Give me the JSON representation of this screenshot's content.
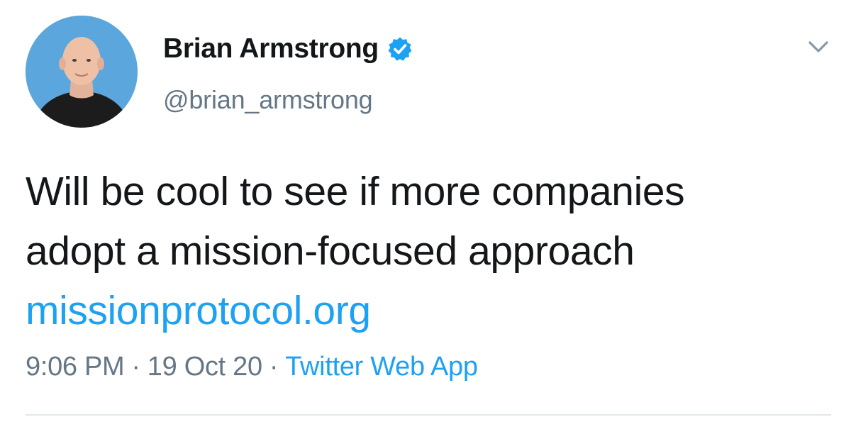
{
  "author": {
    "display_name": "Brian Armstrong",
    "handle": "@brian_armstrong",
    "verified": true
  },
  "tweet": {
    "text_line1": "Will be cool to see if more companies",
    "text_line2": "adopt a mission-focused approach",
    "link": "missionprotocol.org"
  },
  "meta": {
    "time": "9:06 PM",
    "separator": "·",
    "date": "19 Oct 20",
    "source": "Twitter Web App"
  },
  "icons": {
    "verified": "verified-badge-icon",
    "menu": "chevron-down-icon"
  },
  "colors": {
    "text": "#14171a",
    "secondary": "#657786",
    "link": "#1da1f2",
    "verified": "#1da1f2",
    "divider": "#e1e8ed",
    "avatar_bg": "#5aa6dd"
  }
}
